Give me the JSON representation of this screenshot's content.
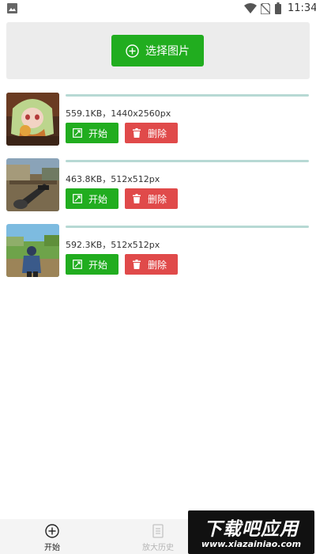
{
  "status_bar": {
    "time": "11:34",
    "icons": [
      "gallery-icon",
      "wifi-icon",
      "no-sim-icon",
      "battery-icon"
    ]
  },
  "select_button": {
    "label": "选择图片",
    "icon": "plus-circle-icon"
  },
  "images": [
    {
      "info": "559.1KB，1440x2560px",
      "progress": 1.0,
      "start_label": "开始",
      "delete_label": "删除",
      "thumb": "anime-character"
    },
    {
      "info": "463.8KB，512x512px",
      "progress": 1.0,
      "start_label": "开始",
      "delete_label": "删除",
      "thumb": "shooter-game"
    },
    {
      "info": "592.3KB，512x512px",
      "progress": 1.0,
      "start_label": "开始",
      "delete_label": "删除",
      "thumb": "survival-game"
    }
  ],
  "bottom_nav": [
    {
      "label": "开始",
      "icon": "plus-circle-icon",
      "active": true
    },
    {
      "label": "放大历史",
      "icon": "document-icon",
      "active": false
    }
  ],
  "watermark": {
    "title": "下载吧应用",
    "url": "www.xiazainiao.com"
  },
  "colors": {
    "accent_green": "#21ad1f",
    "delete_red": "#e04a4a",
    "panel_gray": "#ececec",
    "progress": "#b7d9d4"
  }
}
